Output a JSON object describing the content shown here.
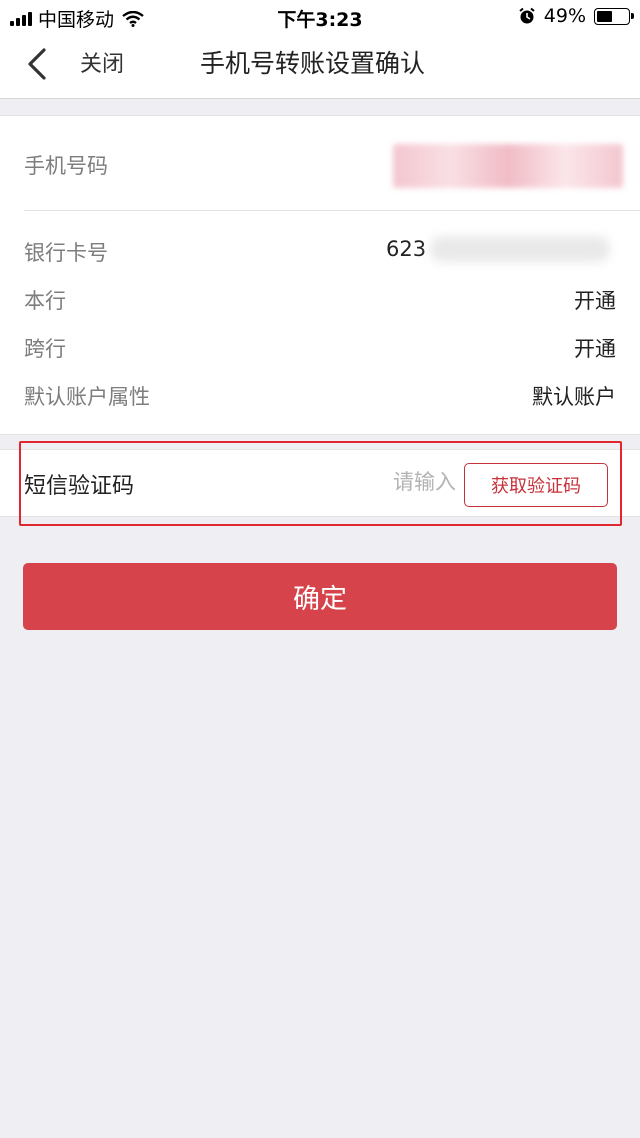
{
  "status_bar": {
    "carrier": "中国移动",
    "time": "下午3:23",
    "battery": "49%",
    "battery_level": 0.49
  },
  "nav": {
    "close_label": "关闭",
    "title": "手机号转账设置确认"
  },
  "info": {
    "phone_label": "手机号码",
    "card_label": "银行卡号",
    "card_prefix": "623",
    "same_bank_label": "本行",
    "same_bank_value": "开通",
    "cross_bank_label": "跨行",
    "cross_bank_value": "开通",
    "default_attr_label": "默认账户属性",
    "default_attr_value": "默认账户"
  },
  "sms": {
    "label": "短信验证码",
    "placeholder": "请输入",
    "get_code_label": "获取验证码"
  },
  "confirm_label": "确定",
  "colors": {
    "accent": "#d6434b",
    "highlight": "#e0262e",
    "background": "#efeef3"
  }
}
